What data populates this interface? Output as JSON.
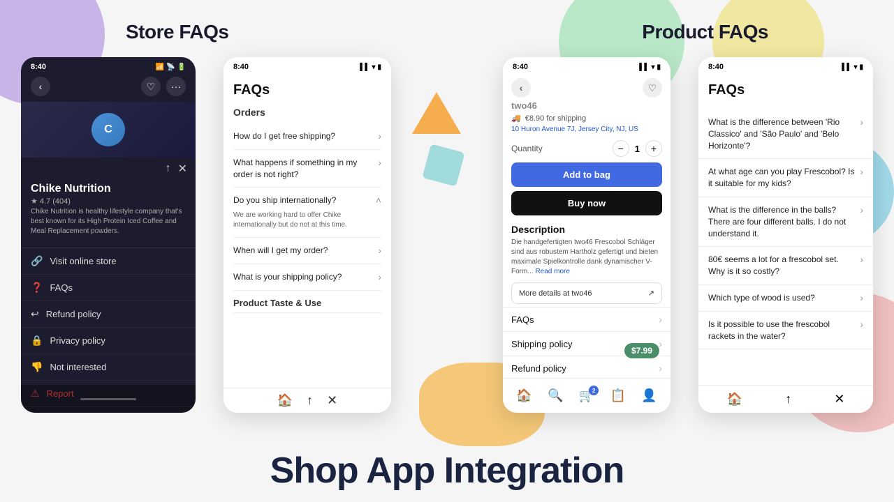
{
  "page": {
    "background": "#f0f0f0"
  },
  "store_section": {
    "title": "Store FAQs"
  },
  "product_section": {
    "title": "Product FAQs"
  },
  "store_panel": {
    "status_time": "8:40",
    "store_name": "Chike Nutrition",
    "rating": "★ 4.7 (404)",
    "description": "Chike Nutrition is healthy lifestyle company that's best known for its High Protein Iced Coffee and Meal Replacement powders.",
    "menu_items": [
      {
        "icon": "🔗",
        "label": "Visit online store"
      },
      {
        "icon": "❓",
        "label": "FAQs"
      },
      {
        "icon": "↩",
        "label": "Refund policy"
      },
      {
        "icon": "🔒",
        "label": "Privacy policy"
      },
      {
        "icon": "👎",
        "label": "Not interested"
      },
      {
        "icon": "⚠",
        "label": "Report",
        "is_report": true
      }
    ]
  },
  "faqs_phone": {
    "status_time": "8:40",
    "title": "FAQs",
    "section_orders": "Orders",
    "faq_items": [
      {
        "question": "How do I get free shipping?",
        "expanded": false
      },
      {
        "question": "What happens if something in my order is not right?",
        "expanded": false
      },
      {
        "question": "Do you ship internationally?",
        "expanded": true,
        "answer": "We are working hard to offer Chike internationally but do not at this time."
      },
      {
        "question": "When will I get my order?",
        "expanded": false
      },
      {
        "question": "What is your shipping policy?",
        "expanded": false
      }
    ],
    "section_product": "Product Taste & Use",
    "bottom_icons": [
      "🏠",
      "🔗",
      "✖"
    ]
  },
  "product_phone": {
    "status_time": "8:40",
    "product_name": "two46",
    "shipping_price": "€8.90 for shipping",
    "address": "10 Huron Avenue 7J, Jersey City, NJ, US",
    "quantity_label": "Quantity",
    "quantity": 1,
    "add_to_bag": "Add to bag",
    "buy_now": "Buy now",
    "description_title": "Description",
    "description_text": "Die handgefertigten two46 Frescobol Schläger sind aus robustem Hartholz gefertigt und bieten maximale Spielkontrolle dank dynamischer V-Form...",
    "read_more": "Read more",
    "more_details": "More details at two46",
    "links": [
      {
        "label": "FAQs"
      },
      {
        "label": "Shipping policy"
      },
      {
        "label": "Refund policy"
      }
    ],
    "price_badge": "$7.99",
    "bottom_icons": [
      "🏠",
      "🔍",
      "🛒",
      "📋",
      "👤"
    ]
  },
  "right_faqs_phone": {
    "status_time": "8:40",
    "title": "FAQs",
    "faq_items": [
      {
        "question": "What is the difference between 'Rio Classico' and 'São Paulo' and 'Belo Horizonte'?",
        "expanded": false
      },
      {
        "question": "At what age can you play Frescobol? Is it suitable for my kids?",
        "expanded": false
      },
      {
        "question": "What is the difference in the balls? There are four different balls. I do not understand it.",
        "expanded": false
      },
      {
        "question": "80€ seems a lot for a frescobol set. Why is it so costly?",
        "expanded": false
      },
      {
        "question": "Which type of wood is used?",
        "expanded": false
      },
      {
        "question": "Is it possible to use the frescobol rackets in the water?",
        "expanded": false
      }
    ],
    "bottom_icons": [
      "🏠",
      "🔗",
      "✖"
    ]
  },
  "bottom": {
    "shop_app_title": "Shop App Integration"
  }
}
